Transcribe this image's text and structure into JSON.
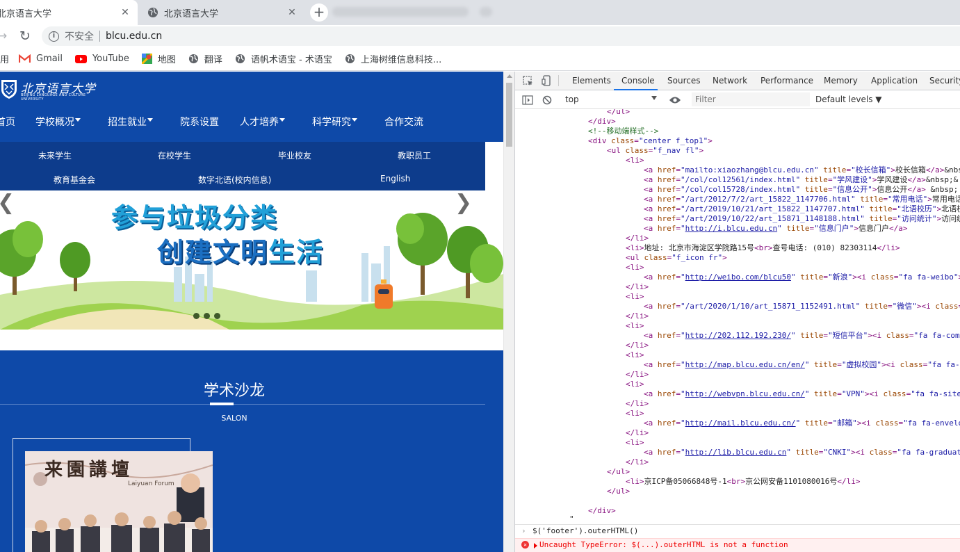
{
  "tabs": [
    {
      "title": "北京语言大学",
      "close": "✕"
    },
    {
      "title": "北京语言大学",
      "close": "✕"
    }
  ],
  "newtab": "+",
  "toolbar": {
    "back": "→",
    "reload": "↻",
    "insecure_label": "不安全",
    "url": "blcu.edu.cn"
  },
  "bookmarks": [
    {
      "label": "用"
    },
    {
      "label": "Gmail"
    },
    {
      "label": "YouTube"
    },
    {
      "label": "地图"
    },
    {
      "label": "翻译"
    },
    {
      "label": "语帆术语宝 - 术语宝"
    },
    {
      "label": "上海树维信息科技..."
    }
  ],
  "site": {
    "logo_cn": "北京语言大学",
    "logo_en": "BEIJING LANGUAGE AND CULTURE UNIVERSITY",
    "nav": [
      "首页",
      "学校概况",
      "招生就业",
      "院系设置",
      "人才培养",
      "科学研究",
      "合作交流"
    ],
    "subnav_row1": [
      "未来学生",
      "在校学生",
      "毕业校友",
      "教职员工"
    ],
    "subnav_row2": [
      "教育基金会",
      "数字北语(校内信息)",
      "English"
    ],
    "banner_slogan1": "参与垃圾分类",
    "banner_slogan2a": "创建文明",
    "banner_slogan2b": "生活",
    "arrow_prev": "❮",
    "arrow_next": "❯",
    "salon_title": "学术沙龙",
    "salon_sub": "SALON",
    "photo_text1": "来園講壇",
    "photo_text2": "Laiyuan Forum"
  },
  "devtools": {
    "tabs": [
      "Elements",
      "Console",
      "Sources",
      "Network",
      "Performance",
      "Memory",
      "Application",
      "Security"
    ],
    "active_tab": "Console",
    "context": "top",
    "filter_placeholder": "Filter",
    "levels": "Default levels ▼",
    "console_input": "$('footer').outerHTML()",
    "error": "Uncaught TypeError: $(...).outerHTML is not a function"
  },
  "colors": {
    "site_blue": "#0e49a8",
    "devtools_accent": "#1a73e8",
    "error_red": "#e00000"
  }
}
